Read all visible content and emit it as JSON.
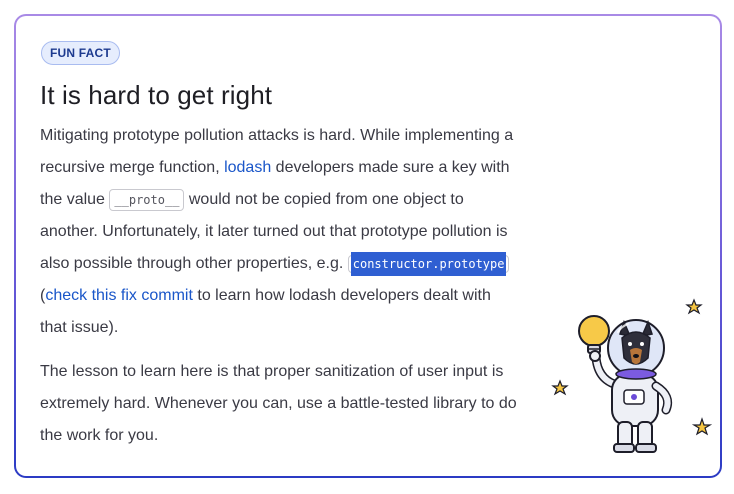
{
  "badge": "FUN FACT",
  "title": "It is hard to get right",
  "paragraph1": {
    "part1": "Mitigating prototype pollution attacks is hard. While implementing a recursive merge function, ",
    "link_lodash": "lodash",
    "part2": " developers made sure a key with the value ",
    "code_proto": "__proto__",
    "part3": " would not be copied from one object to another. Unfortunately, it later turned out that prototype pollution is also possible through other properties, e.g. ",
    "code_constructor": "constructor.prototype",
    "part4": " (",
    "link_commit": "check this fix commit",
    "part5": " to learn how lodash developers dealt with that issue)."
  },
  "paragraph2": "The lesson to learn here is that proper sanitization of user input is extremely hard. Whenever you can, use a battle-tested library to do the work for you.",
  "colors": {
    "accent": "#1a56c9",
    "selection": "#2f5fd2",
    "badge_bg": "#e6edfd",
    "border_gradient": [
      "#a98ae6",
      "#2b3bc4"
    ]
  },
  "icons": [
    "lightbulb-icon",
    "star-icon",
    "astronaut-dog-illustration"
  ]
}
